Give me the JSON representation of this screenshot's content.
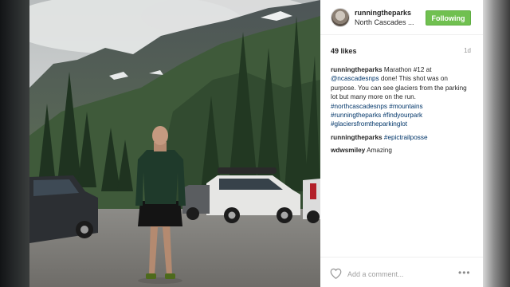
{
  "post": {
    "username": "runningtheparks",
    "location": "North Cascades ...",
    "follow_label": "Following",
    "likes": "49 likes",
    "time": "1d",
    "caption": {
      "user": "runningtheparks",
      "text_1": " Marathon #12 at ",
      "mention": "@ncascadesnps",
      "text_2": " done! This shot was on purpose. You can see glaciers from the parking lot but many more on the run. ",
      "hashtags": "#northcascadesnps #mountains #runningtheparks #findyourpark #glaciersfromtheparkinglot"
    },
    "comments": [
      {
        "user": "runningtheparks",
        "text": "#epictrailposse"
      },
      {
        "user": "wdwsmiley",
        "text": "Amazing"
      }
    ],
    "add_comment_placeholder": "Add a comment...",
    "more_label": "•••"
  },
  "colors": {
    "follow_button": "#70c050",
    "link": "#003569",
    "text": "#262626"
  },
  "icons": {
    "avatar": "avatar",
    "like": "heart-icon",
    "more": "more-options-icon"
  }
}
